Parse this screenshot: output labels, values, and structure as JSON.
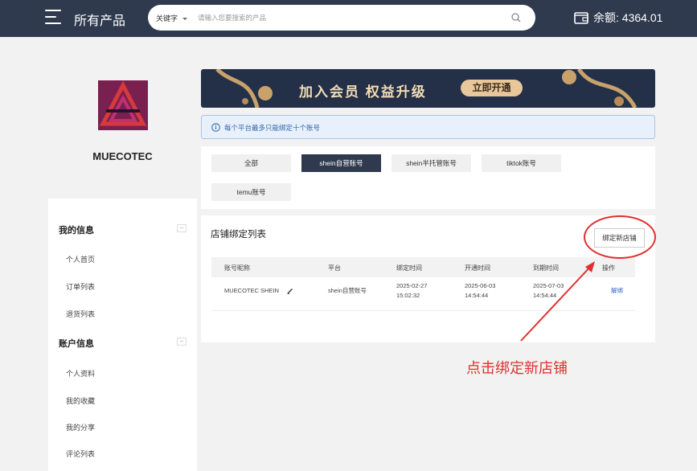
{
  "header": {
    "title": "所有产品",
    "search": {
      "type_label": "关键字",
      "placeholder": "请输入您要搜索的产品"
    },
    "balance": "余额: 4364.01"
  },
  "profile": {
    "username": "MUECOTEC"
  },
  "sidebar": {
    "groups": [
      {
        "label": "我的信息",
        "toggle": "−",
        "items": [
          "个人首页",
          "订单列表",
          "退货列表"
        ]
      },
      {
        "label": "账户信息",
        "toggle": "−",
        "items": [
          "个人资料",
          "我的收藏",
          "我的分享",
          "评论列表"
        ]
      }
    ]
  },
  "banner": {
    "title": "加入会员 权益升级",
    "cta": "立即开通"
  },
  "notice": "每个平台最多只能绑定十个账号",
  "tabs": [
    {
      "label": "全部",
      "active": false
    },
    {
      "label": "shein自营账号",
      "active": true
    },
    {
      "label": "shein半托管账号",
      "active": false
    },
    {
      "label": "tiktok账号",
      "active": false
    },
    {
      "label": "temu账号",
      "active": false
    }
  ],
  "store_list": {
    "title": "店铺绑定列表",
    "bind_button": "绑定新店铺",
    "columns": [
      "账号昵称",
      "平台",
      "绑定时间",
      "开通时间",
      "到期时间",
      "操作"
    ],
    "rows": [
      {
        "nickname": "MUECOTEC SHEIN",
        "platform": "shein自营账号",
        "bind_date": "2025-02-27",
        "bind_time": "15:02:32",
        "open_date": "2025-06-03",
        "open_time": "14:54:44",
        "expire_date": "2025-07-03",
        "expire_time": "14:54:44",
        "action": "解绑"
      }
    ]
  },
  "annotation": {
    "hint": "点击绑定新店铺",
    "color": "#e03030"
  },
  "colors": {
    "header_bg": "#2f3a4e",
    "active_tab": "#2f3a4e",
    "link": "#3366cc"
  }
}
